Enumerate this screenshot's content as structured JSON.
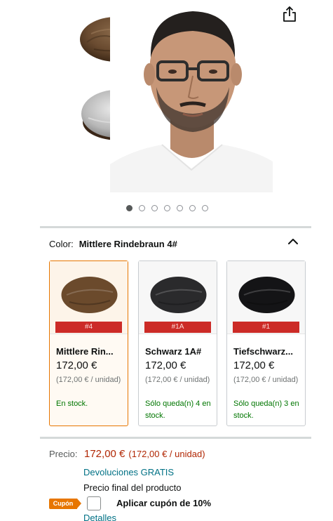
{
  "gallery": {
    "share_icon": "share-icon",
    "slide_count": 7,
    "active_slide": 1
  },
  "variation": {
    "label": "Color:",
    "selected_value": "Mittlere Rindebraun 4#",
    "toggle_icon": "chevron-up-icon",
    "options": [
      {
        "tag": "#4",
        "name": "Mittlere Rin...",
        "price": "172,00 €",
        "unit_price": "(172,00 € / unidad)",
        "stock": "En stock.",
        "selected": true,
        "color": "#6b4a2c"
      },
      {
        "tag": "#1A",
        "name": "Schwarz 1A#",
        "price": "172,00 €",
        "unit_price": "(172,00 € / unidad)",
        "stock": "Sólo queda(n) 4 en stock.",
        "selected": false,
        "color": "#2a2a2c"
      },
      {
        "tag": "#1",
        "name": "Tiefschwarz...",
        "price": "172,00 €",
        "unit_price": "(172,00 € / unidad)",
        "stock": "Sólo queda(n) 3 en stock.",
        "selected": false,
        "color": "#141416"
      }
    ]
  },
  "pricing": {
    "label": "Precio:",
    "price": "172,00 €",
    "unit_price": "(172,00 € / unidad)",
    "returns": "Devoluciones GRATIS",
    "final_note": "Precio final del producto"
  },
  "coupon": {
    "badge": "Cupón",
    "text": "Aplicar cupón de 10%",
    "checked": false
  },
  "details_link": "Detalles",
  "colors": {
    "accent_orange": "#e77600",
    "price_red": "#b12704",
    "link_teal": "#007185",
    "stock_green": "#007600",
    "tag_red": "#cc2b27"
  }
}
